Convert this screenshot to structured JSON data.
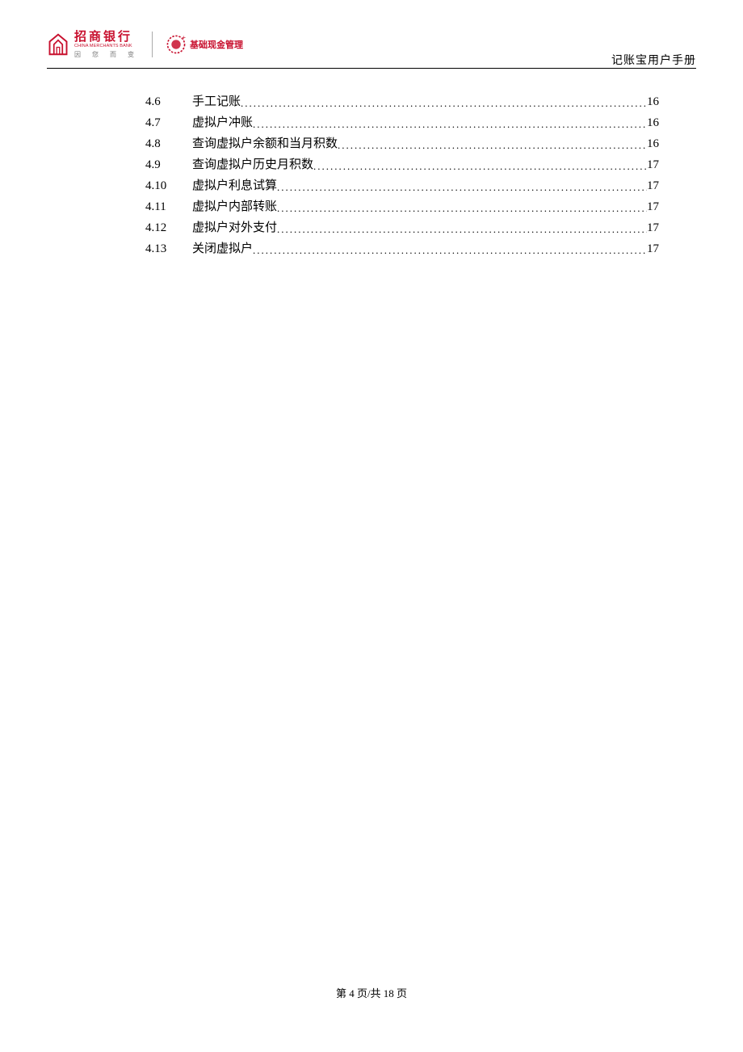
{
  "header": {
    "bank_name_cn": "招商银行",
    "bank_name_en": "CHINA MERCHANTS BANK",
    "bank_slogan": "因 您 而 变",
    "product_name": "基础现金管理",
    "doc_title": "记账宝用户手册"
  },
  "toc": [
    {
      "num": "4.6",
      "title": "手工记账",
      "page": "16"
    },
    {
      "num": "4.7",
      "title": "虚拟户冲账",
      "page": "16"
    },
    {
      "num": "4.8",
      "title": "查询虚拟户余额和当月积数",
      "page": "16"
    },
    {
      "num": "4.9",
      "title": "查询虚拟户历史月积数",
      "page": "17"
    },
    {
      "num": "4.10",
      "title": "虚拟户利息试算",
      "page": "17"
    },
    {
      "num": "4.11",
      "title": "虚拟户内部转账",
      "page": "17"
    },
    {
      "num": "4.12",
      "title": "虚拟户对外支付",
      "page": "17"
    },
    {
      "num": "4.13",
      "title": "关闭虚拟户",
      "page": "17"
    }
  ],
  "footer": {
    "page_label": "第 4 页/共 18 页"
  }
}
